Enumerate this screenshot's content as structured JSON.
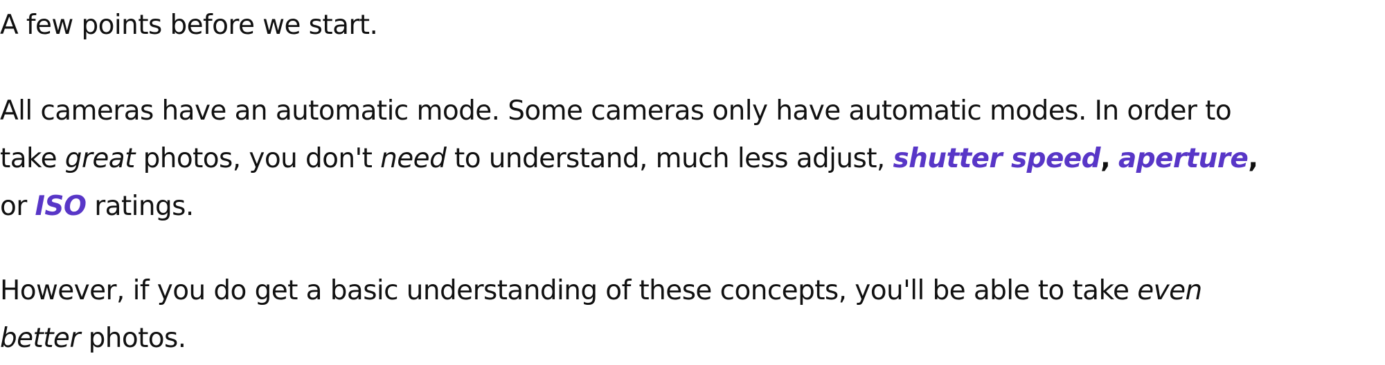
{
  "paragraph1": {
    "text": "A few points before we start."
  },
  "paragraph2": {
    "line1": "All cameras have an automatic mode. Some cameras only have automatic modes. In order to",
    "line2_a": "take ",
    "line2_great": "great",
    "line2_b": " photos, you don't ",
    "line2_need": "need",
    "line2_c": " to understand, much less adjust, ",
    "term_shutter": "shutter speed",
    "comma1": ",",
    "space1": " ",
    "term_aperture": "aperture",
    "comma2": ",",
    "line3_a": "or ",
    "term_iso": "ISO",
    "line3_b": " ratings."
  },
  "paragraph3": {
    "line1_a": "However, if you do get a basic understanding of these concepts, you'll be able to take ",
    "line1_even": "even",
    "line2_better": "better",
    "line2_b": " photos."
  },
  "colors": {
    "link_term": "#5836c7",
    "body_text": "#111111",
    "background": "#ffffff"
  }
}
